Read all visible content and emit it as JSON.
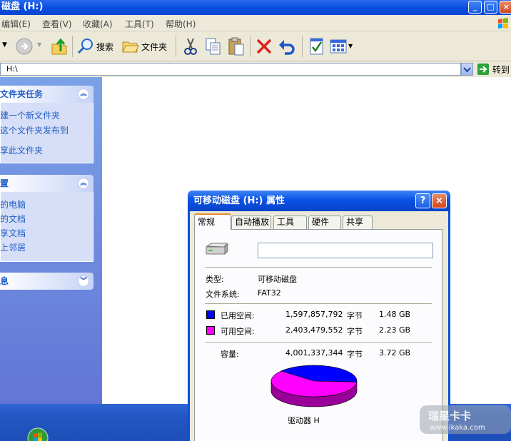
{
  "window": {
    "title": "磁盘  (H:)"
  },
  "menu": {
    "items": [
      "编辑(E)",
      "查看(V)",
      "收藏(A)",
      "工具(T)",
      "帮助(H)"
    ]
  },
  "toolbar": {
    "search_label": "搜索",
    "folders_label": "文件夹"
  },
  "address": {
    "value": "H:\\",
    "go_label": "转到"
  },
  "tasks": {
    "file_header": "文件夹任务",
    "file_links": [
      "建一个新文件夹",
      "这个文件夹发布到",
      "享此文件夹"
    ],
    "places_header": "置",
    "places_links": [
      "的电脑",
      "的文档",
      "享文档",
      "上邻居"
    ],
    "details_header": "息"
  },
  "dialog": {
    "title": "可移动磁盘 (H:) 属性",
    "tabs": [
      "常规",
      "自动播放",
      "工具",
      "硬件",
      "共享"
    ],
    "name_value": "",
    "type_label": "类型:",
    "type_value": "可移动磁盘",
    "fs_label": "文件系统:",
    "fs_value": "FAT32",
    "used_label": "已用空间:",
    "used_bytes": "1,597,857,792",
    "used_unit": "字节",
    "used_size": "1.48 GB",
    "free_label": "可用空间:",
    "free_bytes": "2,403,479,552",
    "free_unit": "字节",
    "free_size": "2.23 GB",
    "capacity_label": "容量:",
    "capacity_bytes": "4,001,337,344",
    "capacity_unit": "字节",
    "capacity_size": "3.72 GB",
    "drive_label": "驱动器 H",
    "used_color": "#0000ff",
    "free_color": "#ff00ff",
    "used_fraction": 0.3993
  },
  "watermark": {
    "brand": "瑞星卡卡",
    "url": "www.ikaka.com"
  }
}
